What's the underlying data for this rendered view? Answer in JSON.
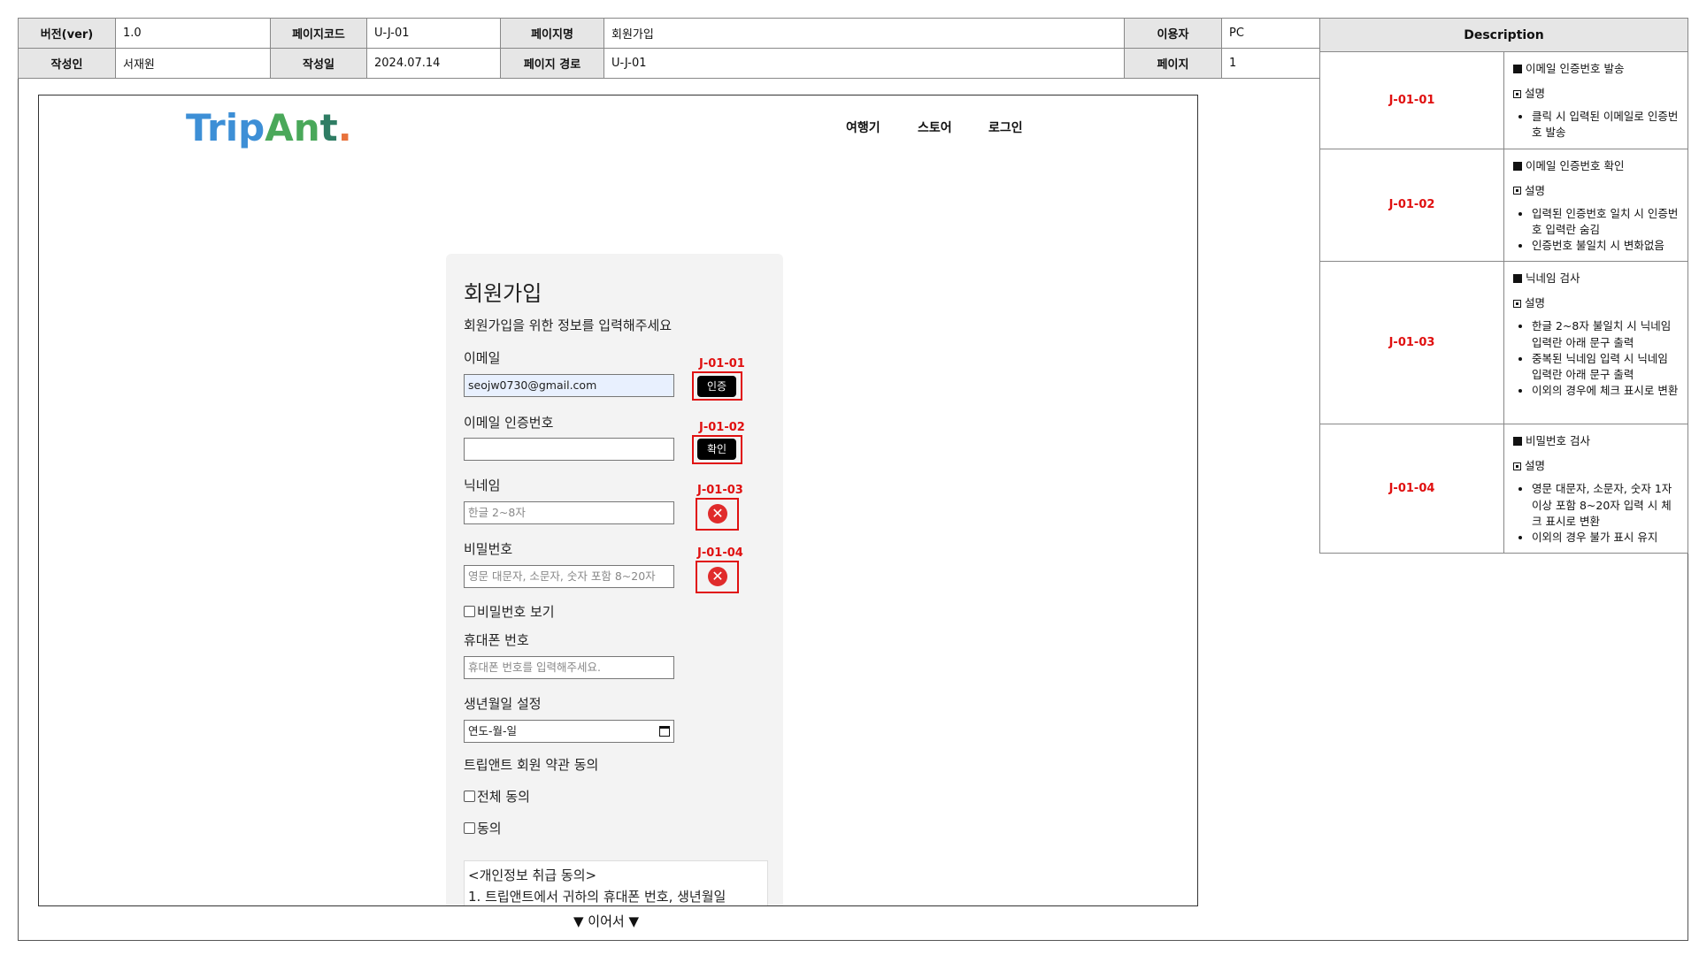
{
  "meta": {
    "version_label": "버전(ver)",
    "version": "1.0",
    "pagecode_label": "페이지코드",
    "pagecode": "U-J-01",
    "pagename_label": "페이지명",
    "pagename": "회원가입",
    "user_label": "이용자",
    "user": "PC",
    "author_label": "작성인",
    "author": "서재원",
    "date_label": "작성일",
    "date": "2024.07.14",
    "path_label": "페이지 경로",
    "path": "U-J-01",
    "page_label": "페이지",
    "page": "1"
  },
  "desc": {
    "header": "Description",
    "items": [
      {
        "code": "J-01-01",
        "title": "이메일 인증번호 발송",
        "sub": "설명",
        "bullets": [
          "클릭 시 입력된 이메일로 인증번호 발송"
        ]
      },
      {
        "code": "J-01-02",
        "title": "이메일 인증번호 확인",
        "sub": "설명",
        "bullets": [
          "입력된 인증번호 일치 시 인증번호 입력란 숨김",
          "인증번호 불일치 시 변화없음"
        ]
      },
      {
        "code": "J-01-03",
        "title": "닉네임 검사",
        "sub": "설명",
        "bullets": [
          "한글 2~8자 불일치 시 닉네임 입력란 아래 문구 출력",
          "중복된 닉네임 입력 시 닉네임 입력란 아래 문구 출력",
          "이외의 경우에 체크 표시로 변환"
        ]
      },
      {
        "code": "J-01-04",
        "title": "비밀번호 검사",
        "sub": "설명",
        "bullets": [
          "영문 대문자, 소문자, 숫자 1자 이상 포함 8~20자 입력 시 체크 표시로 변환",
          "이외의 경우 불가 표시 유지"
        ]
      }
    ]
  },
  "header": {
    "logo": {
      "p1": "Trip",
      "p2": "An",
      "p3": "t",
      "dot": "."
    },
    "nav": [
      "여행기",
      "스토어",
      "로그인"
    ]
  },
  "form": {
    "title": "회원가입",
    "subtitle": "회원가입을 위한 정보를 입력해주세요",
    "email_label": "이메일",
    "email_value": "seojw0730@gmail.com",
    "verify_button": "인증",
    "code_label": "이메일 인증번호",
    "code_value": "",
    "confirm_button": "확인",
    "nickname_label": "닉네임",
    "nickname_placeholder": "한글 2~8자",
    "password_label": "비밀번호",
    "password_placeholder": "영문 대문자, 소문자, 숫자 포함 8~20자",
    "show_password": "비밀번호 보기",
    "phone_label": "휴대폰 번호",
    "phone_placeholder": "휴대폰 번호를 입력해주세요.",
    "birth_label": "생년월일 설정",
    "birth_value": "연도-월-일",
    "terms_label": "트립앤트 회원 약관 동의",
    "agree_all": "전체 동의",
    "agree": "동의",
    "terms_line1": "<개인정보 취급 동의>",
    "terms_line2": "1. 트립앤트에서 귀하의 휴대폰 번호, 생년월일"
  },
  "annotations": [
    "J-01-01",
    "J-01-02",
    "J-01-03",
    "J-01-04"
  ],
  "continue_text": "▼ 이어서 ▼",
  "colors": {
    "annotation": "#e01010",
    "header_bg": "#e6e6e6",
    "card_bg": "#f3f3f3",
    "logo_blue": "#3d8fd6",
    "logo_green": "#4aa85a",
    "logo_dot": "#e8723c"
  }
}
